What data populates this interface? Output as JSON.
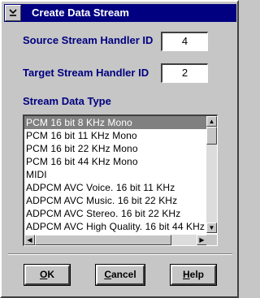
{
  "window": {
    "title": "Create Data Stream"
  },
  "source": {
    "label": "Source Stream Handler ID",
    "value": "4"
  },
  "target": {
    "label": "Target Stream Handler ID",
    "value": "2"
  },
  "stream_type": {
    "label": "Stream Data Type",
    "selected": "PCM 16 bit 8 KHz Mono",
    "items": [
      "PCM 16 bit 8 KHz  Mono",
      "PCM 16 bit 11 KHz  Mono",
      "PCM 16 bit 22 KHz  Mono",
      "PCM 16 bit 44 KHz  Mono",
      "MIDI",
      "ADPCM AVC Voice. 16 bit 11 KHz",
      "ADPCM AVC Music. 16 bit 22 KHz",
      "ADPCM AVC Stereo. 16 bit 22 KHz",
      "ADPCM AVC High Quality. 16 bit 44 KHz"
    ]
  },
  "buttons": {
    "ok": "OK",
    "cancel": "Cancel",
    "help": "Help"
  },
  "icons": {
    "system_menu": "system-menu-icon",
    "scroll_up": "arrow-up-icon",
    "scroll_down": "arrow-down-icon",
    "scroll_left": "arrow-left-icon",
    "scroll_right": "arrow-right-icon"
  },
  "colors": {
    "title_bar": "#000080",
    "label_text": "#000080",
    "selection": "#808080",
    "face": "#c6c6c6"
  }
}
